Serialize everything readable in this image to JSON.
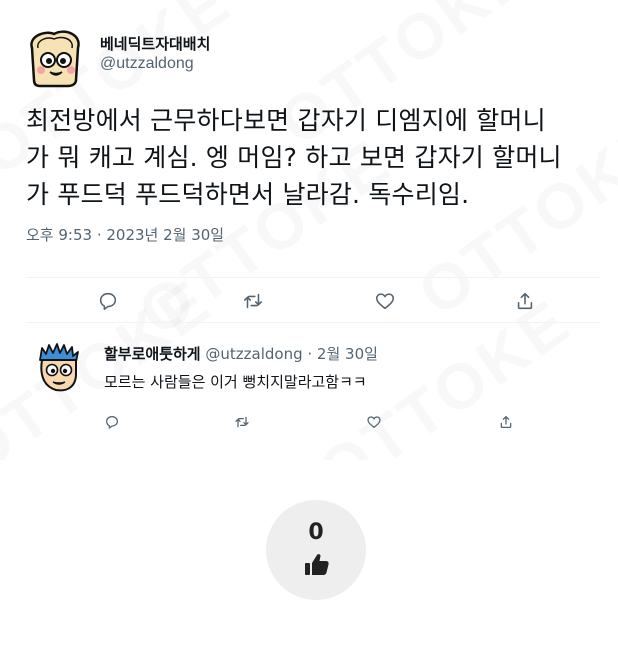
{
  "watermark": {
    "text": "OTTOKE"
  },
  "tweet": {
    "display_name": "베네딕트자대배치",
    "handle": "@utzzaldong",
    "text_lines": [
      "최전방에서 근무하다보면 갑자기 디엠지에 할머니",
      "가 뭐 캐고 계심. 엥 머임? 하고 보면 갑자기 할머니",
      "가 푸드덕 푸드덕하면서 날라감. 독수리임."
    ],
    "timestamp": "오후 9:53 · 2023년 2월 30일",
    "icons": {
      "reply": "reply-icon",
      "retweet": "retweet-icon",
      "like": "heart-icon",
      "share": "share-icon"
    }
  },
  "reply": {
    "display_name": "할부로애툿하게",
    "meta": "@utzzaldong · 2월 30일",
    "text": "모르는 사람들은 이거 뻥치지말라고함ㅋㅋ"
  },
  "like_widget": {
    "count": "0",
    "icon": "thumbs-up-icon"
  },
  "colors": {
    "text": "#0f1419",
    "secondary": "#536471",
    "divider": "#eff3f4",
    "like_bg": "#eeeeee"
  }
}
